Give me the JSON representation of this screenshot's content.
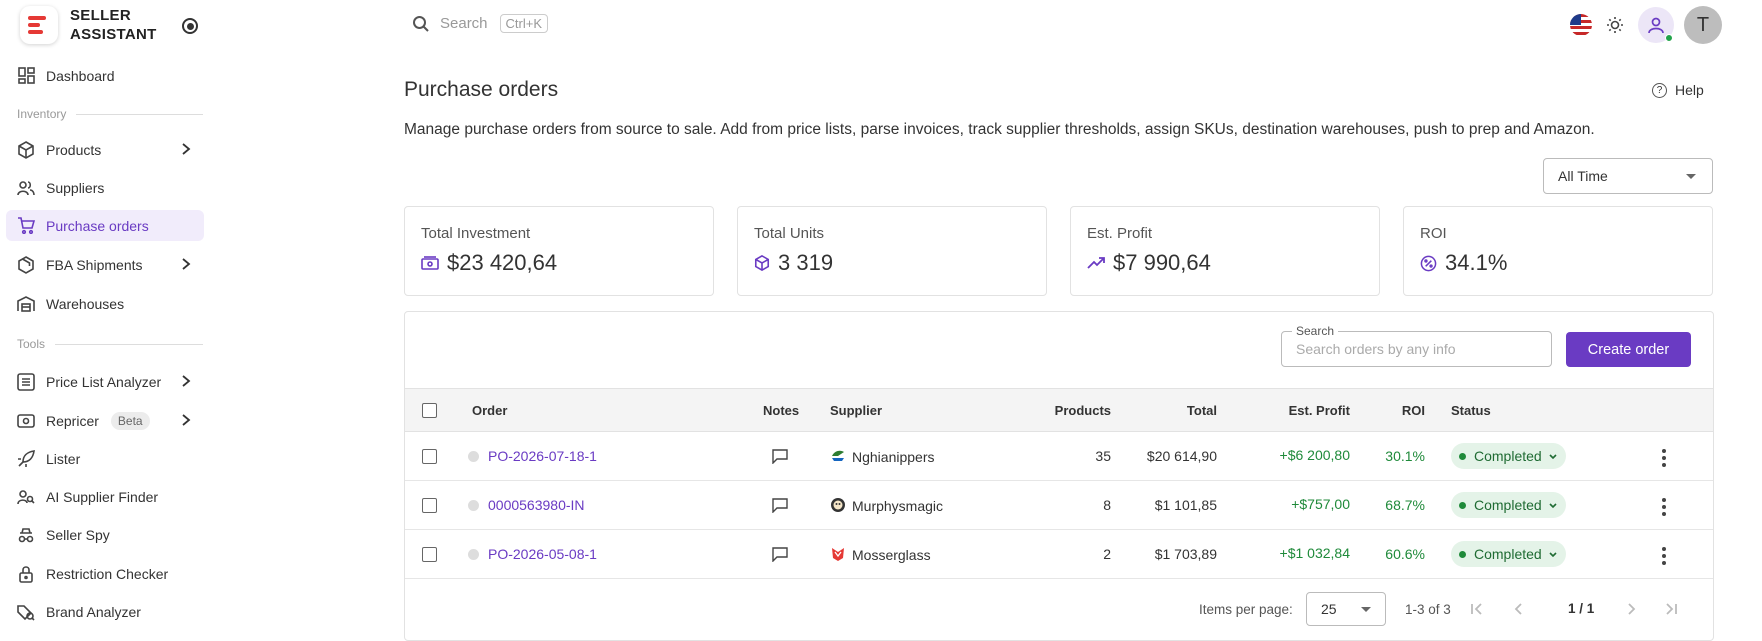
{
  "brand": {
    "line1": "SELLER",
    "line2": "ASSISTANT"
  },
  "sidebar": {
    "dashboard": "Dashboard",
    "section_inventory": "Inventory",
    "products": "Products",
    "suppliers": "Suppliers",
    "purchase_orders": "Purchase orders",
    "fba_shipments": "FBA Shipments",
    "warehouses": "Warehouses",
    "section_tools": "Tools",
    "price_list_analyzer": "Price List Analyzer",
    "repricer": "Repricer",
    "repricer_badge": "Beta",
    "lister": "Lister",
    "ai_supplier_finder": "AI Supplier Finder",
    "seller_spy": "Seller Spy",
    "restriction_checker": "Restriction Checker",
    "brand_analyzer": "Brand Analyzer"
  },
  "topbar": {
    "search_placeholder": "Search",
    "search_shortcut": "Ctrl+K",
    "avatar_letter": "T"
  },
  "page": {
    "title": "Purchase orders",
    "help": "Help",
    "description": "Manage purchase orders from source to sale. Add from price lists, parse invoices, track supplier thresholds, assign SKUs, destination warehouses, push to prep and Amazon.",
    "range": "All Time"
  },
  "stats": {
    "investment_label": "Total Investment",
    "investment_value": "$23 420,64",
    "units_label": "Total Units",
    "units_value": "3 319",
    "profit_label": "Est. Profit",
    "profit_value": "$7 990,64",
    "roi_label": "ROI",
    "roi_value": "34.1%"
  },
  "orders_search": {
    "legend": "Search",
    "placeholder": "Search orders by any info"
  },
  "create_order": "Create order",
  "table": {
    "headers": {
      "order": "Order",
      "notes": "Notes",
      "supplier": "Supplier",
      "products": "Products",
      "total": "Total",
      "profit": "Est. Profit",
      "roi": "ROI",
      "status": "Status"
    },
    "rows": [
      {
        "order": "PO-2026-07-18-1",
        "supplier": "Nghianippers",
        "products": "35",
        "total": "$20 614,90",
        "profit": "+$6 200,80",
        "roi": "30.1%",
        "status": "Completed"
      },
      {
        "order": "0000563980-IN",
        "supplier": "Murphysmagic",
        "products": "8",
        "total": "$1 101,85",
        "profit": "+$757,00",
        "roi": "68.7%",
        "status": "Completed"
      },
      {
        "order": "PO-2026-05-08-1",
        "supplier": "Mosserglass",
        "products": "2",
        "total": "$1 703,89",
        "profit": "+$1 032,84",
        "roi": "60.6%",
        "status": "Completed"
      }
    ]
  },
  "pagination": {
    "items_label": "Items per page:",
    "per_page": "25",
    "range": "1-3 of 3",
    "page": "1 / 1"
  },
  "colors": {
    "accent": "#6a3bc3",
    "positive": "#1f8a3a",
    "brand_red": "#e53935"
  }
}
